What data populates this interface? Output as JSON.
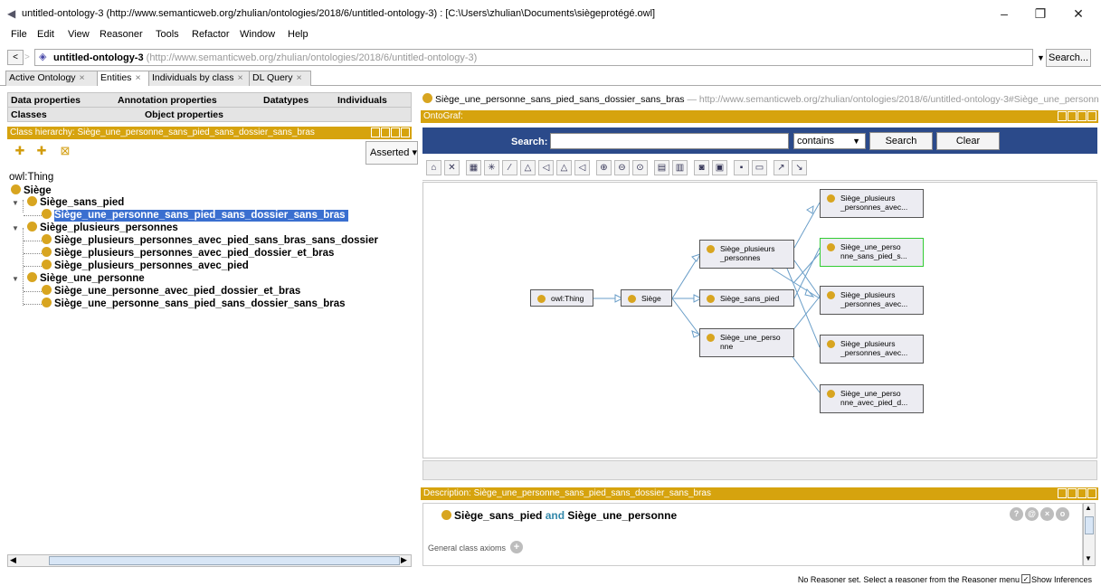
{
  "window": {
    "title": "untitled-ontology-3 (http://www.semanticweb.org/zhulian/ontologies/2018/6/untitled-ontology-3) : [C:\\Users\\zhulian\\Documents\\siègeprotégé.owl]",
    "minimize": "–",
    "maximize": "❐",
    "close": "✕"
  },
  "menu": [
    "File",
    "Edit",
    "View",
    "Reasoner",
    "Tools",
    "Refactor",
    "Window",
    "Help"
  ],
  "address": {
    "back": "<",
    "forward": ">",
    "ontology_name": "untitled-ontology-3",
    "ontology_iri": "(http://www.semanticweb.org/zhulian/ontologies/2018/6/untitled-ontology-3)",
    "search_label": "Search..."
  },
  "tabs": [
    {
      "label": "Active Ontology",
      "close": "×",
      "active": false
    },
    {
      "label": "Entities",
      "close": "×",
      "active": true
    },
    {
      "label": "Individuals by class",
      "close": "×",
      "active": false
    },
    {
      "label": "DL Query",
      "close": "×",
      "active": false
    }
  ],
  "left": {
    "subtabs_row1": [
      "Data properties",
      "Annotation properties",
      "Datatypes",
      "Individuals"
    ],
    "subtabs_row2": [
      "Classes",
      "Object properties"
    ],
    "hierarchy_title": "Class hierarchy: Siège_une_personne_sans_pied_sans_dossier_sans_bras",
    "asserted_label": "Asserted",
    "tree": {
      "root": "owl:Thing",
      "n1": "Siège",
      "n2": "Siège_sans_pied",
      "n3": "Siège_une_personne_sans_pied_sans_dossier_sans_bras",
      "n4": "Siège_plusieurs_personnes",
      "n5": "Siège_plusieurs_personnes_avec_pied_sans_bras_sans_dossier",
      "n6": "Siège_plusieurs_personnes_avec_pied_dossier_et_bras",
      "n7": "Siège_plusieurs_personnes_avec_pied",
      "n8": "Siège_une_personne",
      "n9": "Siège_une_personne_avec_pied_dossier_et_bras",
      "n10": "Siège_une_personne_sans_pied_sans_dossier_sans_bras"
    }
  },
  "right": {
    "entity_name": "Siège_une_personne_sans_pied_sans_dossier_sans_bras",
    "entity_iri": " — http://www.semanticweb.org/zhulian/ontologies/2018/6/untitled-ontology-3#Siège_une_personn",
    "ontograf_title": "OntoGraf:",
    "search_label": "Search:",
    "search_value": "",
    "search_mode": "contains",
    "search_button": "Search",
    "clear_button": "Clear",
    "graph": {
      "g_thing": "owl:Thing",
      "g_siege": "Siège",
      "g_sans_pied": "Siège_sans_pied",
      "g_plusieurs_l1": "Siège_plusieurs",
      "g_plusieurs_l2": "_personnes",
      "g_une_l1": "Siège_une_perso",
      "g_une_l2": "nne",
      "r1_l1": "Siège_plusieurs",
      "r1_l2": "_personnes_avec...",
      "r2_l1": "Siège_une_perso",
      "r2_l2": "nne_sans_pied_s...",
      "r3_l1": "Siège_plusieurs",
      "r3_l2": "_personnes_avec...",
      "r4_l1": "Siège_plusieurs",
      "r4_l2": "_personnes_avec...",
      "r5_l1": "Siège_une_perso",
      "r5_l2": "nne_avec_pied_d..."
    },
    "description_title": "Description: Siège_une_personne_sans_pied_sans_dossier_sans_bras",
    "desc_class1": "Siège_sans_pied",
    "desc_and": "and",
    "desc_class2": "Siège_une_personne",
    "general_class_axioms": "General class axioms",
    "desc_buttons": [
      "?",
      "@",
      "×",
      "o"
    ]
  },
  "status": {
    "message": "No Reasoner set. Select a reasoner from the Reasoner menu",
    "show_inferences": "Show Inferences",
    "checked_mark": "✓"
  },
  "colors": {
    "accent": "#d6a30e",
    "selection": "#3a6fd0",
    "search_panel": "#2b4a8a"
  }
}
